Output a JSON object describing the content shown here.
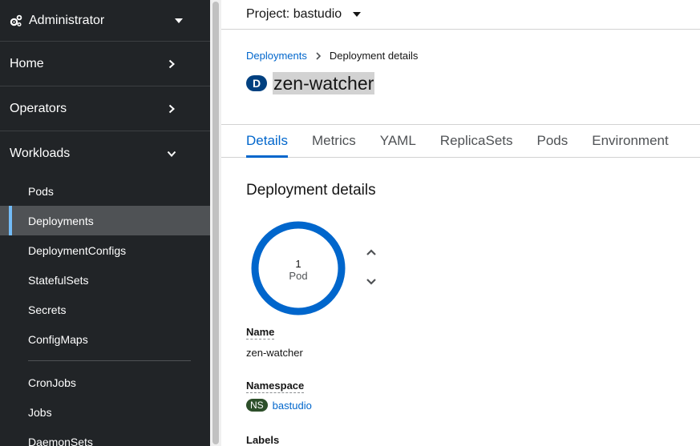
{
  "sidebar": {
    "perspective": {
      "label": "Administrator",
      "icon": "gears-icon"
    },
    "sections": [
      {
        "label": "Home",
        "expanded": false
      },
      {
        "label": "Operators",
        "expanded": false
      },
      {
        "label": "Workloads",
        "expanded": true
      }
    ],
    "workloads_items": [
      {
        "label": "Pods",
        "active": false
      },
      {
        "label": "Deployments",
        "active": true
      },
      {
        "label": "DeploymentConfigs",
        "active": false
      },
      {
        "label": "StatefulSets",
        "active": false
      },
      {
        "label": "Secrets",
        "active": false
      },
      {
        "label": "ConfigMaps",
        "active": false
      }
    ],
    "workloads_items_2": [
      {
        "label": "CronJobs"
      },
      {
        "label": "Jobs"
      },
      {
        "label": "DaemonSets"
      }
    ]
  },
  "project": {
    "label": "Project: bastudio"
  },
  "breadcrumb": {
    "parent": "Deployments",
    "current": "Deployment details"
  },
  "resource": {
    "badge": "D",
    "name": "zen-watcher"
  },
  "tabs": [
    "Details",
    "Metrics",
    "YAML",
    "ReplicaSets",
    "Pods",
    "Environment"
  ],
  "active_tab": "Details",
  "details": {
    "section_title": "Deployment details",
    "pod_count": "1",
    "pod_unit": "Pod",
    "name_label": "Name",
    "name_value": "zen-watcher",
    "namespace_label": "Namespace",
    "namespace_badge": "NS",
    "namespace_value": "bastudio",
    "labels_label": "Labels"
  },
  "colors": {
    "sidebar_bg": "#212427",
    "active_item_bg": "#4f5255",
    "active_indicator": "#73bcf7",
    "link": "#0066cc",
    "donut": "#0066cc",
    "deployment_badge": "#004080",
    "namespace_badge": "#2d4f2a"
  }
}
